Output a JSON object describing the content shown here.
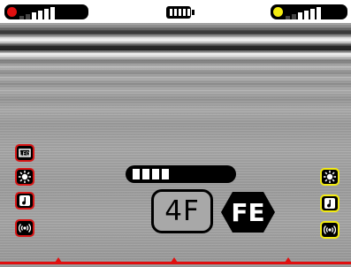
{
  "status_bar": {
    "left_channel": {
      "indicator_color": "#e01010",
      "signal_bars_active": 4,
      "signal_bars_total": 6
    },
    "battery": {
      "icon": "battery-icon",
      "level_fraction": 1.0
    },
    "right_channel": {
      "indicator_color": "#f4ec10",
      "signal_bars_active": 4,
      "signal_bars_total": 6
    }
  },
  "left_controls": {
    "accent_color": "#d81616",
    "icons": [
      "led-icon",
      "brightness-icon",
      "sound-icon",
      "vibration-icon"
    ]
  },
  "right_controls": {
    "accent_color": "#f2ea10",
    "icons": [
      "brightness-icon",
      "sound-icon",
      "vibration-icon"
    ]
  },
  "depth_gauge": {
    "segments_filled": 4,
    "segments_total": 10
  },
  "mode_label": "4F",
  "material_badge": "FE",
  "baseline": {
    "color": "#e01010"
  }
}
